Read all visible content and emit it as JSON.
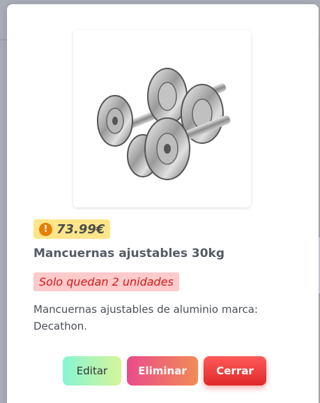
{
  "product": {
    "price": "73.99€",
    "price_icon": "warning-icon",
    "name": "Mancuernas ajustables 30kg",
    "stock_message": "Solo quedan 2 unidades",
    "description": "Mancuernas ajustables de aluminio marca: Decathon."
  },
  "actions": {
    "edit_label": "Editar",
    "delete_label": "Eliminar",
    "close_label": "Cerrar"
  },
  "colors": {
    "price_badge": "#fde68a",
    "stock_badge": "#fecaca",
    "stock_text": "#d11a1a",
    "close_button": "#e02828"
  }
}
